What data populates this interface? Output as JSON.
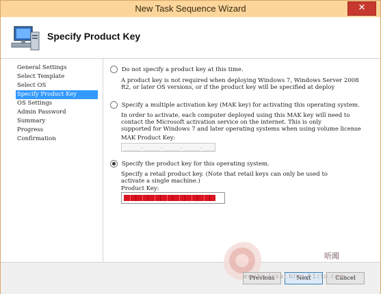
{
  "window": {
    "title": "New Task Sequence Wizard",
    "close_glyph": "✕"
  },
  "header": {
    "title": "Specify Product Key",
    "icon": "computer-icon"
  },
  "sidebar": {
    "items": [
      {
        "label": "General Settings"
      },
      {
        "label": "Select Template"
      },
      {
        "label": "Select OS"
      },
      {
        "label": "Specify Product Key",
        "active": true
      },
      {
        "label": "OS Settings"
      },
      {
        "label": "Admin Password"
      },
      {
        "label": "Summary"
      },
      {
        "label": "Progress"
      },
      {
        "label": "Confirmation"
      }
    ]
  },
  "options": {
    "none": {
      "label": "Do not specify a product key at this time.",
      "desc1": "A product key is not required when deploying Windows 7, Windows Server 2008",
      "desc2": "R2, or later OS versions, or if the product key will be specified at deploy",
      "selected": false
    },
    "mak": {
      "label": "Specify a multiple activation key (MAK key) for activating this operating system.",
      "desc1": "In order to activate, each computer deployed using this MAK key will need to",
      "desc2": "contact the Microsoft activation service on the internet.  This is only",
      "desc3": "supported for Windows 7 and later operating systems when using volume license",
      "field_label": "MAK Product Key:",
      "field_value": "_____-_____-_____-_____-_____",
      "selected": false
    },
    "retail": {
      "label": "Specify the product key for this operating system.",
      "desc1": "Specify a retail product key.  (Note that retail keys can only be used to",
      "desc2": "activate a single machine.)",
      "field_label": "Product Key:",
      "selected": true
    }
  },
  "footer": {
    "previous_label": "Previous",
    "next_label": "Next",
    "cancel_label": "Cancel",
    "watermark_text": "听闻",
    "watermark_url": "wenbo.lasaf.blog.51cto.com"
  }
}
